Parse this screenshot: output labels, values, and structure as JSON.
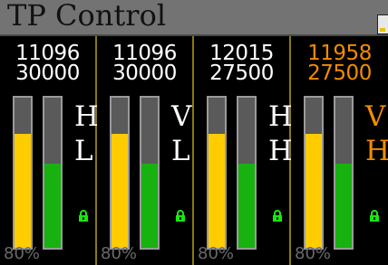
{
  "title": "TP Control",
  "panels": [
    {
      "top": "11096",
      "bottom": "30000",
      "letter1": "H",
      "letter2": "L",
      "yellow_fill": 0.76,
      "green_fill": 0.56,
      "percent": "80%",
      "highlight": false
    },
    {
      "top": "11096",
      "bottom": "30000",
      "letter1": "V",
      "letter2": "L",
      "yellow_fill": 0.76,
      "green_fill": 0.56,
      "percent": "80%",
      "highlight": false
    },
    {
      "top": "12015",
      "bottom": "27500",
      "letter1": "H",
      "letter2": "H",
      "yellow_fill": 0.76,
      "green_fill": 0.56,
      "percent": "80%",
      "highlight": false
    },
    {
      "top": "11958",
      "bottom": "27500",
      "letter1": "V",
      "letter2": "H",
      "yellow_fill": 0.76,
      "green_fill": 0.56,
      "percent": "80%",
      "highlight": true
    }
  ],
  "colors": {
    "yellow": "#ffcc00",
    "green": "#17b20f",
    "orange": "#f28c00",
    "titlebar": "#737373"
  },
  "icons": {
    "lock": "lock-icon",
    "corner": "status-icon"
  }
}
